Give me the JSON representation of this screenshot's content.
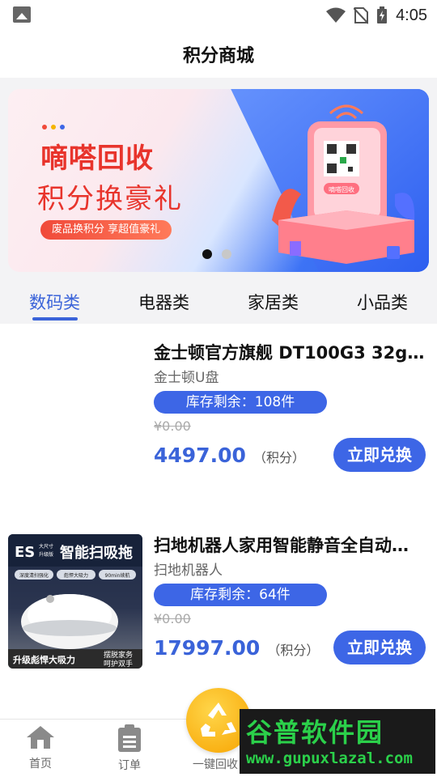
{
  "status_bar": {
    "time": "4:05"
  },
  "header": {
    "title": "积分商城"
  },
  "banner": {
    "title_line1": "嘀嗒回收",
    "title_line2": "积分换豪礼",
    "tagline": "废品换积分 享超值豪礼",
    "art_badge": "嘀嗒回收",
    "page_count": 2,
    "active_page": 1
  },
  "tabs": [
    {
      "label": "数码类",
      "active": true
    },
    {
      "label": "电器类",
      "active": false
    },
    {
      "label": "家居类",
      "active": false
    },
    {
      "label": "小品类",
      "active": false
    }
  ],
  "products": [
    {
      "name": "金士顿官方旗舰 DT100G3 32gu…",
      "category": "金士顿U盘",
      "stock": "库存剩余：108件",
      "original_price": "¥0.00",
      "points_price": "4497.00",
      "points_unit": "（积分）",
      "redeem_label": "立即兑换",
      "has_image": false
    },
    {
      "name": "扫地机器人家用智能静音全自动…",
      "category": "扫地机器人",
      "stock": "库存剩余：64件",
      "original_price": "¥0.00",
      "points_price": "17997.00",
      "points_unit": "（积分）",
      "redeem_label": "立即兑换",
      "has_image": true,
      "image_text": {
        "brand": "ES",
        "size_note_1": "大尺寸",
        "size_note_2": "升级版",
        "headline": "智能扫吸拖",
        "chip_1": "深度清扫强化",
        "chip_2": "彪悍大吸力",
        "chip_3": "90min续航",
        "bottom_left": "升级彪悍大吸力",
        "bottom_right_1": "摆脱家务",
        "bottom_right_2": "呵护双手"
      }
    }
  ],
  "tab_bar": {
    "home_label": "首页",
    "orders_label": "订单",
    "recycle_label": "一键回收"
  },
  "watermark": {
    "title": "谷普软件园",
    "url": "www.gupuxlazal.com"
  },
  "colors": {
    "accent": "#3d66e6",
    "banner_red": "#e8342c",
    "fab": "#f7a300"
  }
}
